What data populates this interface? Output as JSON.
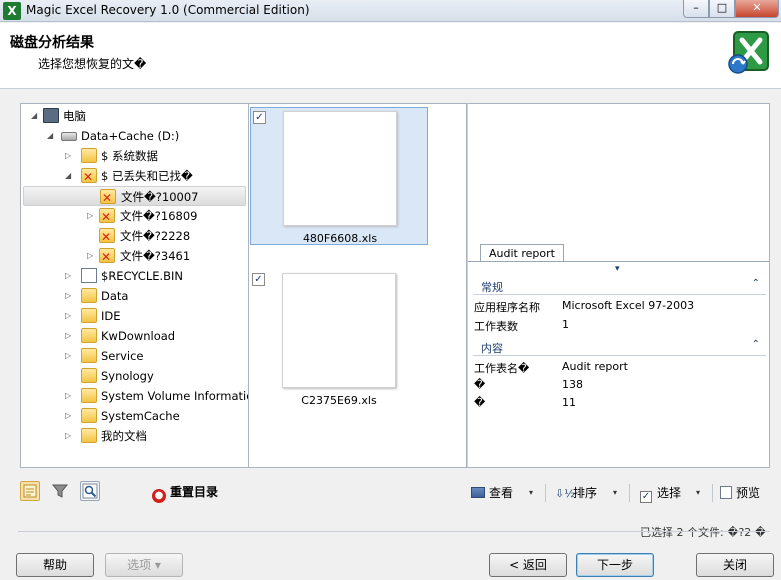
{
  "window": {
    "title": "Magic Excel Recovery 1.0 (Commercial Edition)",
    "app_icon": "X",
    "controls": {
      "minimize": "–",
      "maximize": "□",
      "close": "✕"
    }
  },
  "header": {
    "title": "磁盘分析结果",
    "subtitle": "选择您想恢复的文�"
  },
  "tree": {
    "items": [
      {
        "label": "电脑",
        "icon": "computer-icon",
        "arrow": "◢"
      },
      {
        "label": "Data+Cache (D:)",
        "icon": "drive-icon",
        "arrow": "◢"
      },
      {
        "label": "$ 系统数据",
        "icon": "folder-icon",
        "arrow": "▷"
      },
      {
        "label": "$ 已丢失和已找�",
        "icon": "folder-deleted-icon",
        "arrow": "◢"
      },
      {
        "label": "文件�?10007",
        "icon": "folder-deleted-icon",
        "arrow": ""
      },
      {
        "label": "文件�?16809",
        "icon": "folder-deleted-icon",
        "arrow": "▷"
      },
      {
        "label": "文件�?2228",
        "icon": "folder-deleted-icon",
        "arrow": ""
      },
      {
        "label": "文件�?3461",
        "icon": "folder-deleted-icon",
        "arrow": "▷"
      },
      {
        "label": "$RECYCLE.BIN",
        "icon": "recycle-bin-icon",
        "arrow": "▷"
      },
      {
        "label": "Data",
        "icon": "folder-icon",
        "arrow": "▷"
      },
      {
        "label": "IDE",
        "icon": "folder-icon",
        "arrow": "▷"
      },
      {
        "label": "KwDownload",
        "icon": "folder-icon",
        "arrow": "▷"
      },
      {
        "label": "Service",
        "icon": "folder-icon",
        "arrow": "▷"
      },
      {
        "label": "Synology",
        "icon": "folder-icon",
        "arrow": ""
      },
      {
        "label": "System Volume Information",
        "icon": "folder-icon",
        "arrow": "▷"
      },
      {
        "label": "SystemCache",
        "icon": "folder-icon",
        "arrow": "▷"
      },
      {
        "label": "我的文档",
        "icon": "folder-icon",
        "arrow": "▷"
      }
    ]
  },
  "files": [
    {
      "name": "480F6608.xls",
      "checked": "✓",
      "selected": true
    },
    {
      "name": "C2375E69.xls",
      "checked": "✓",
      "selected": false
    }
  ],
  "properties": {
    "tab": "Audit report",
    "collapse_marker": "▾",
    "groups": [
      {
        "title": "常规",
        "caret": "⌃",
        "rows": [
          {
            "name": "应用程序名称",
            "value": "Microsoft Excel 97-2003"
          },
          {
            "name": "工作表数",
            "value": "1"
          }
        ]
      },
      {
        "title": "内容",
        "caret": "⌃",
        "rows": [
          {
            "name": "工作表名�",
            "value": "Audit report"
          },
          {
            "name": "�",
            "value": "138"
          },
          {
            "name": "�",
            "value": "11"
          }
        ]
      }
    ]
  },
  "toolbar": {
    "reset": "重置目录",
    "view": "查看",
    "sort": "排序",
    "select": "选择",
    "preview": "预览",
    "dropdown_glyph": "▾"
  },
  "status": {
    "text": "已选择 2 个文件: �?2 �"
  },
  "buttons": {
    "help": "帮助",
    "options": "选项 ▾",
    "back": "< 返回",
    "next": "下一步",
    "close": "关闭"
  },
  "colors": {
    "selection_bg": "#d9e7f7",
    "selection_border": "#7fa9d8",
    "deleted_mark": "#d8261c",
    "reset_red": "#d0201b",
    "logo_green": "#1e7b31"
  }
}
